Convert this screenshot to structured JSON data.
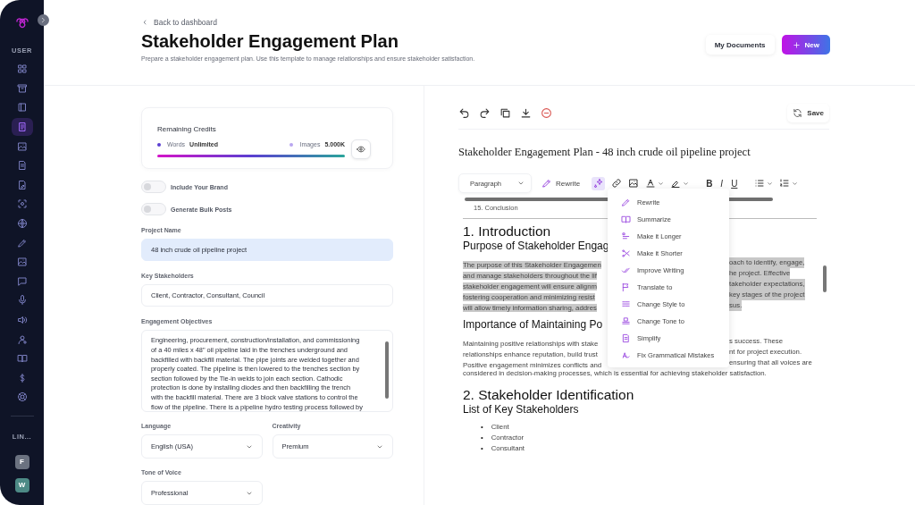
{
  "sidebar": {
    "section_label": "USER",
    "items": [
      {
        "selected": false
      },
      {
        "selected": false
      },
      {
        "selected": false
      },
      {
        "selected": true
      },
      {
        "selected": false
      },
      {
        "selected": false
      },
      {
        "selected": false
      },
      {
        "selected": false
      },
      {
        "selected": false
      },
      {
        "selected": false
      },
      {
        "selected": false
      },
      {
        "selected": false
      },
      {
        "selected": false
      },
      {
        "selected": false
      },
      {
        "selected": false
      },
      {
        "selected": false
      },
      {
        "selected": false
      },
      {
        "selected": false
      }
    ],
    "links_label": "LIN...",
    "link_badges": [
      {
        "label": "F",
        "color": "#6b7280"
      },
      {
        "label": "W",
        "color": "#4d8a86"
      }
    ]
  },
  "header": {
    "back_link": "Back to dashboard",
    "title": "Stakeholder Engagement Plan",
    "description": "Prepare a stakeholder engagement plan. Use this template to manage relationships and ensure stakeholder satisfaction.",
    "buttons": [
      {
        "label": "My Documents",
        "kind": "secondary"
      },
      {
        "label": "New",
        "kind": "primary"
      }
    ]
  },
  "form": {
    "credits": {
      "title": "Remaining Credits",
      "level": 1,
      "items": [
        {
          "label": "Words",
          "value": "Unlimited",
          "color": "#5b3fd1"
        },
        {
          "label": "Images",
          "value": "5.000K",
          "color": "#b9a6f0"
        }
      ]
    },
    "toggles": [
      {
        "label": "Include Your Brand",
        "on": false
      },
      {
        "label": "Generate Bulk Posts",
        "on": false
      }
    ],
    "fields": [
      {
        "label": "Project Name",
        "value": "48 inch crude oil pipeline project",
        "focused": true
      },
      {
        "label": "Key Stakeholders",
        "value": "Client, Contractor, Consultant, Council",
        "focused": false
      }
    ],
    "objectives": {
      "label": "Engagement Objectives",
      "lines": [
        "Engineering, procurement, construction/installation, and commissioning",
        "of a 40 miles x 48\" oil pipeline laid in the trenches underground and",
        "backfilled with backfill material. The pipe joints are welded together and",
        "properly coated. The pipeline is then lowered to the trenches section by",
        "section followed by the Tie-in welds to join each section. Cathodic",
        "protection is done by installing diodes and then backfilling the trench",
        "with the backfill material. There are 3 block valve stations to control the",
        "flow of the pipeline. There is a pipeline hydro testing process followed by"
      ]
    },
    "selects": [
      {
        "label": "Language",
        "value": "English (USA)"
      },
      {
        "label": "Creativity",
        "value": "Premium"
      },
      {
        "label": "Tone of Voice",
        "value": "Professional"
      }
    ]
  },
  "editor": {
    "save_button": "Save",
    "document_title": "Stakeholder Engagement Plan - 48 inch crude oil pipeline project",
    "toolbar": {
      "block_format": "Paragraph",
      "rewrite_button": "Rewrite",
      "ai_menu_open": true,
      "format_buttons": [
        "B",
        "I",
        "U"
      ]
    },
    "ai_menu": [
      {
        "label": "Rewrite"
      },
      {
        "label": "Summarize"
      },
      {
        "label": "Make it Longer"
      },
      {
        "label": "Make it Shorter"
      },
      {
        "label": "Improve Writing"
      },
      {
        "label": "Translate to"
      },
      {
        "label": "Change Style to"
      },
      {
        "label": "Change Tone to"
      },
      {
        "label": "Simplify"
      },
      {
        "label": "Fix Grammatical Mistakes"
      }
    ],
    "outline_item": "15. Conclusion",
    "blocks": [
      {
        "kind": "h1",
        "text": "1. Introduction"
      },
      {
        "kind": "h2",
        "text": "Purpose of Stakeholder Engag"
      },
      {
        "kind": "para",
        "selected": true,
        "lines": [
          {
            "left": "The purpose of this Stakeholder Engagemen",
            "right": "oach to identify, engage,"
          },
          {
            "left": "and manage stakeholders throughout the lif",
            "right": "he project. Effective"
          },
          {
            "left": "stakeholder engagement will ensure alignm",
            "right": "takeholder expectations,"
          },
          {
            "left": "fostering cooperation and minimizing resist",
            "right": "key stages of the project"
          },
          {
            "left": "will allow timely information sharing, addres",
            "right": "sus."
          }
        ]
      },
      {
        "kind": "h2",
        "text": "Importance of Maintaining Po"
      },
      {
        "kind": "para",
        "selected": false,
        "lines": [
          {
            "left": "Maintaining positive relationships with stake",
            "right": "s success. These"
          },
          {
            "left": "relationships enhance reputation, build trust",
            "right": "nt for project execution."
          },
          {
            "left": "Positive engagement minimizes conflicts and",
            "right": "ensuring that all voices are"
          },
          {
            "left": "considered in decision-making processes, which is essential for achieving stakeholder satisfaction."
          }
        ]
      },
      {
        "kind": "h1",
        "text": "2. Stakeholder Identification"
      },
      {
        "kind": "h2",
        "text": "List of Key Stakeholders"
      },
      {
        "kind": "list",
        "marker": "•",
        "items": [
          "Client",
          "Contractor",
          "Consultant"
        ]
      }
    ]
  }
}
